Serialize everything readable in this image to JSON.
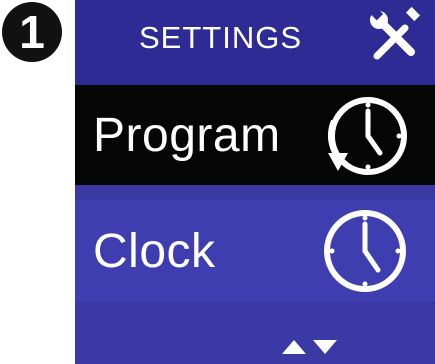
{
  "step_number": "1",
  "header": {
    "title": "SETTINGS",
    "icon": "wrench-screwdriver-icon"
  },
  "menu": {
    "items": [
      {
        "label": "Program",
        "icon": "clock-with-arrow-icon",
        "selected": false
      },
      {
        "label": "Clock",
        "icon": "clock-icon",
        "selected": true
      }
    ]
  },
  "footer": {
    "up_icon": "arrow-up-icon",
    "down_icon": "arrow-down-icon"
  },
  "colors": {
    "header_bg": "#2e2c94",
    "screen_bg": "#3b3aa5",
    "selected_bg": "#3f3eb1",
    "unselected_bg": "#050505",
    "text": "#ffffff"
  }
}
